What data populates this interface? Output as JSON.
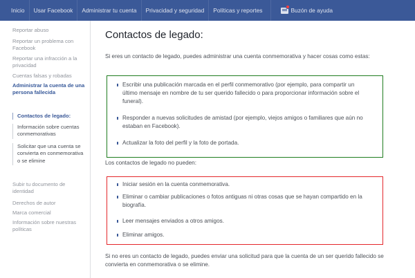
{
  "topbar": {
    "nav": [
      "Inicio",
      "Usar Facebook",
      "Administrar tu cuenta",
      "Privacidad y seguridad",
      "Políticas y reportes"
    ],
    "help_label": "Buzón de ayuda"
  },
  "sidebar": {
    "links": [
      "Reportar abuso",
      "Reportar un problema con Facebook",
      "Reportar una infracción a la privacidad",
      "Cuentas falsas y robadas"
    ],
    "current": "Administrar la cuenta de una persona fallecida",
    "subitems": [
      "Contactos de legado:",
      "Información sobre cuentas conmemorativas",
      "Solicitar que una cuenta se convierta en conmemorativa o se elimine"
    ],
    "bottom_links": [
      "Subir tu documento de identidad",
      "Derechos de autor",
      "Marca comercial",
      "Información sobre nuestras políticas"
    ]
  },
  "main": {
    "title": "Contactos de legado:",
    "intro": "Si eres un contacto de legado, puedes administrar una cuenta conmemorativa y hacer cosas como estas:",
    "can": [
      "Escribir una publicación marcada en el perfil conmemorativo (por ejemplo, para compartir un último mensaje en nombre de tu ser querido fallecido o para proporcionar información sobre el funeral).",
      "Responder a nuevas solicitudes de amistad (por ejemplo, viejos amigos o familiares que aún no estaban en Facebook).",
      "Actualizar la foto del perfil y la foto de portada."
    ],
    "cannot_heading": "Los contactos de legado no pueden:",
    "cannot": [
      "Iniciar sesión en la cuenta conmemorativa.",
      "Eliminar o cambiar publicaciones o fotos antiguas ni otras cosas que se hayan compartido en la biografía.",
      "Leer mensajes enviados a otros amigos.",
      "Eliminar amigos."
    ],
    "outro": "Si no eres un contacto de legado, puedes enviar una solicitud para que la cuenta de un ser querido fallecido se convierta en conmemorativa o se elimine."
  },
  "colors": {
    "topbar": "#3b5998",
    "green_box": "#1e7c1e",
    "red_box": "#e4262a"
  }
}
